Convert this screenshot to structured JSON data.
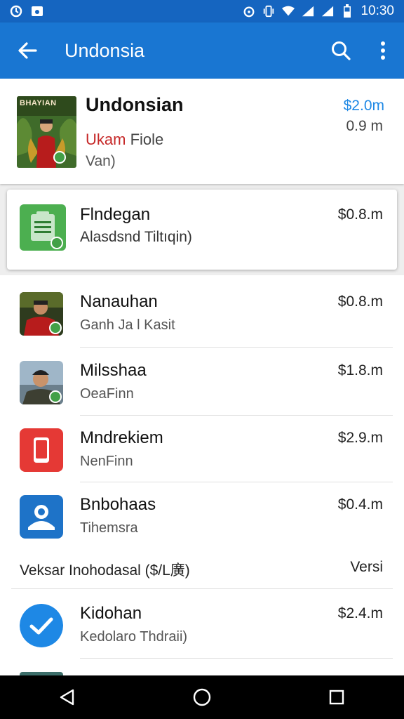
{
  "status_bar": {
    "time": "10:30"
  },
  "app_bar": {
    "title": "Undonsia"
  },
  "featured": {
    "thumb_label": "BHAYIAN",
    "name": "Undonsian",
    "sub_red": "Ukam",
    "sub_gray": "Fiole",
    "sub2": "Van)",
    "price": "$2.0m",
    "size": "0.9 m"
  },
  "selected": {
    "name": "Flndegan",
    "sub": "Alasdsnd Tiltıqin)",
    "price": "$0.8.m"
  },
  "rows": [
    {
      "name": "Nanauhan",
      "sub": "Ganh Ja l Kasit",
      "price": "$0.8.m",
      "icon": "portrait-red-icon"
    },
    {
      "name": "Milsshaa",
      "sub": "OeaFinn",
      "price": "$1.8.m",
      "icon": "portrait-cap-icon"
    },
    {
      "name": "Mndrekiem",
      "sub": "NenFinn",
      "price": "$2.9.m",
      "icon": "phone-app-icon"
    },
    {
      "name": "Bnbohaas",
      "sub": "Tihemsra",
      "price": "$0.4.m",
      "icon": "user-app-icon"
    },
    {
      "name": "Kidohan",
      "sub": "Kedolaro Thdraii)",
      "price": "$2.4.m",
      "icon": "check-app-icon"
    }
  ],
  "note": {
    "left": "Veksar Inohodasal ($/L廣)",
    "right": "Versi"
  },
  "colors": {
    "status_bar": "#1565c0",
    "app_bar": "#1976d2",
    "price_accent": "#1e88e5",
    "badge_green": "#43a047"
  }
}
